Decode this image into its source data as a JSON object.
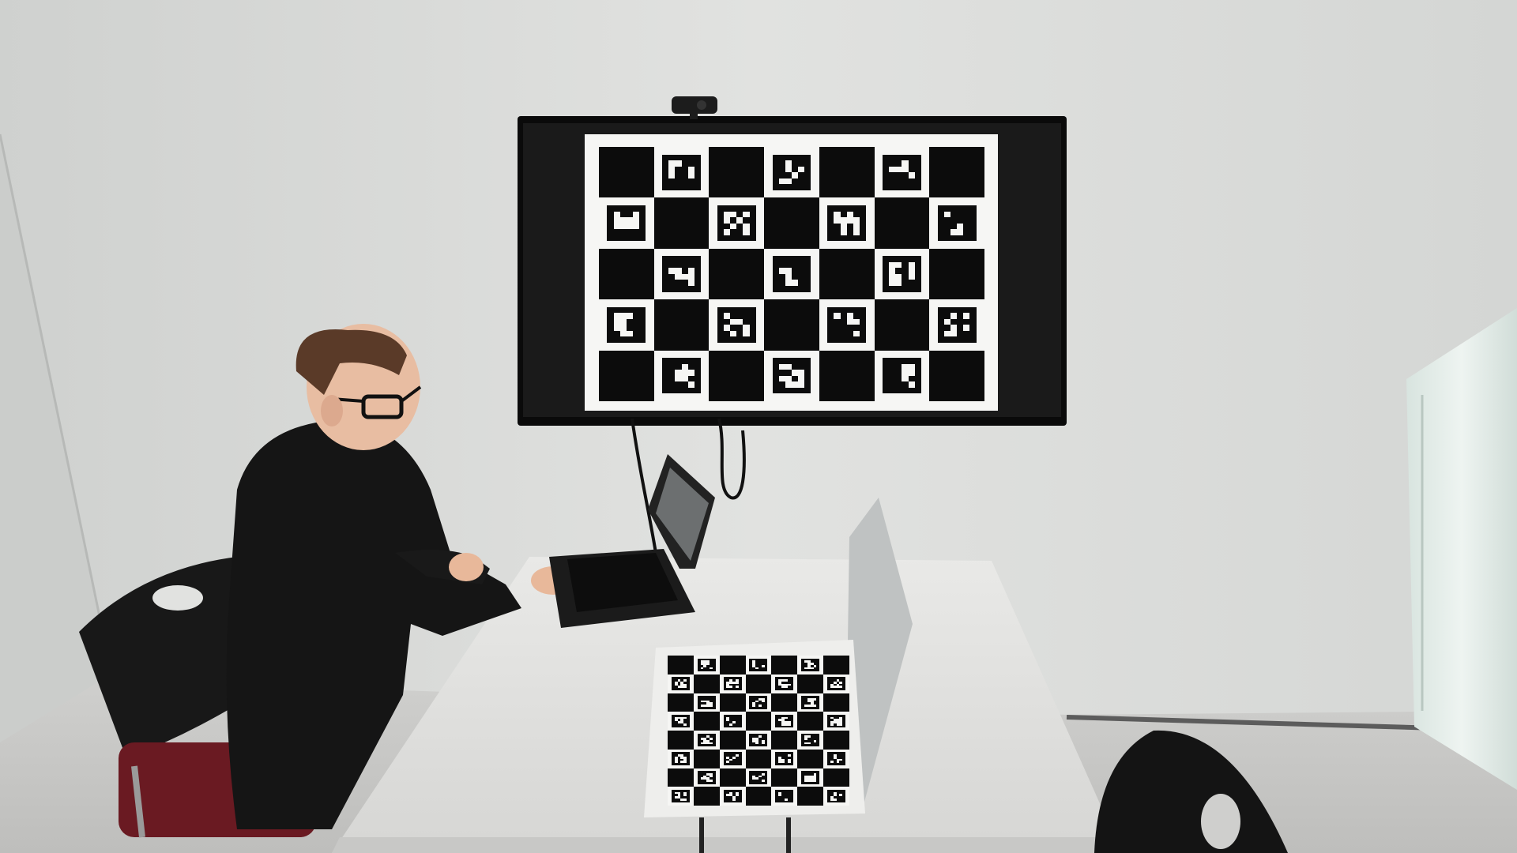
{
  "scene": {
    "description_items": [
      "person",
      "laptop",
      "wall-display",
      "webcam",
      "table",
      "chairs",
      "charuco-board-screen",
      "charuco-board-printed"
    ]
  },
  "board": {
    "cols": 7,
    "rows": 5,
    "black_first": true
  },
  "printed_board": {
    "cols": 7,
    "rows": 8,
    "black_first": true
  },
  "colors": {
    "wall": "#d9dad8",
    "floor": "#c9cac8",
    "table": "#e4e4e2",
    "hoodie": "#151515",
    "chair": "#1a1a1a",
    "seat_accent": "#6a1a22",
    "screen_bezel": "#0a0a0a",
    "board_white": "#f6f6f4",
    "board_black": "#0c0c0c"
  }
}
